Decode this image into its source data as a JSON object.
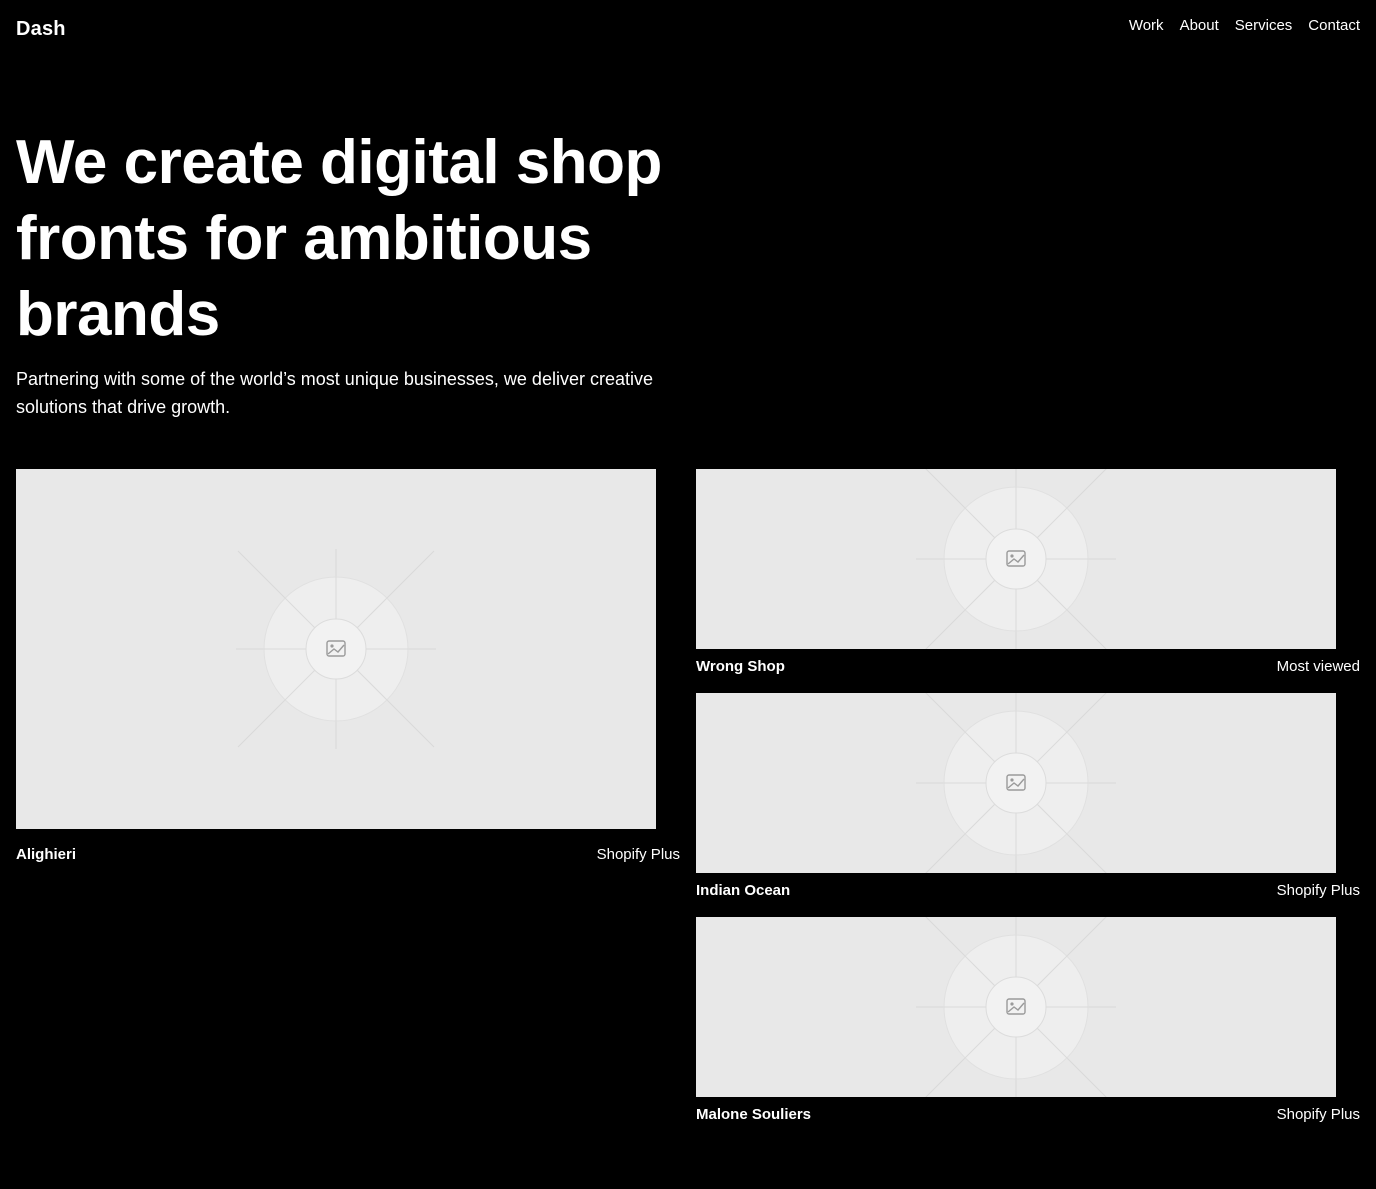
{
  "header": {
    "logo": "Dash",
    "nav": [
      "Work",
      "About",
      "Services",
      "Contact"
    ]
  },
  "hero": {
    "title": "We create digital shop fronts for ambitious brands",
    "subtitle": "Partnering with some of the world’s most unique businesses, we deliver creative solutions that drive growth."
  },
  "projects": [
    {
      "name": "Alighieri",
      "tag": "Shopify Plus",
      "image": "image-placeholder-icon"
    },
    {
      "name": "Wrong Shop",
      "tag": "Most viewed",
      "image": "image-placeholder-icon"
    },
    {
      "name": "Indian Ocean",
      "tag": "Shopify Plus",
      "image": "image-placeholder-icon"
    },
    {
      "name": "Malone Souliers",
      "tag": "Shopify Plus",
      "image": "image-placeholder-icon"
    }
  ]
}
